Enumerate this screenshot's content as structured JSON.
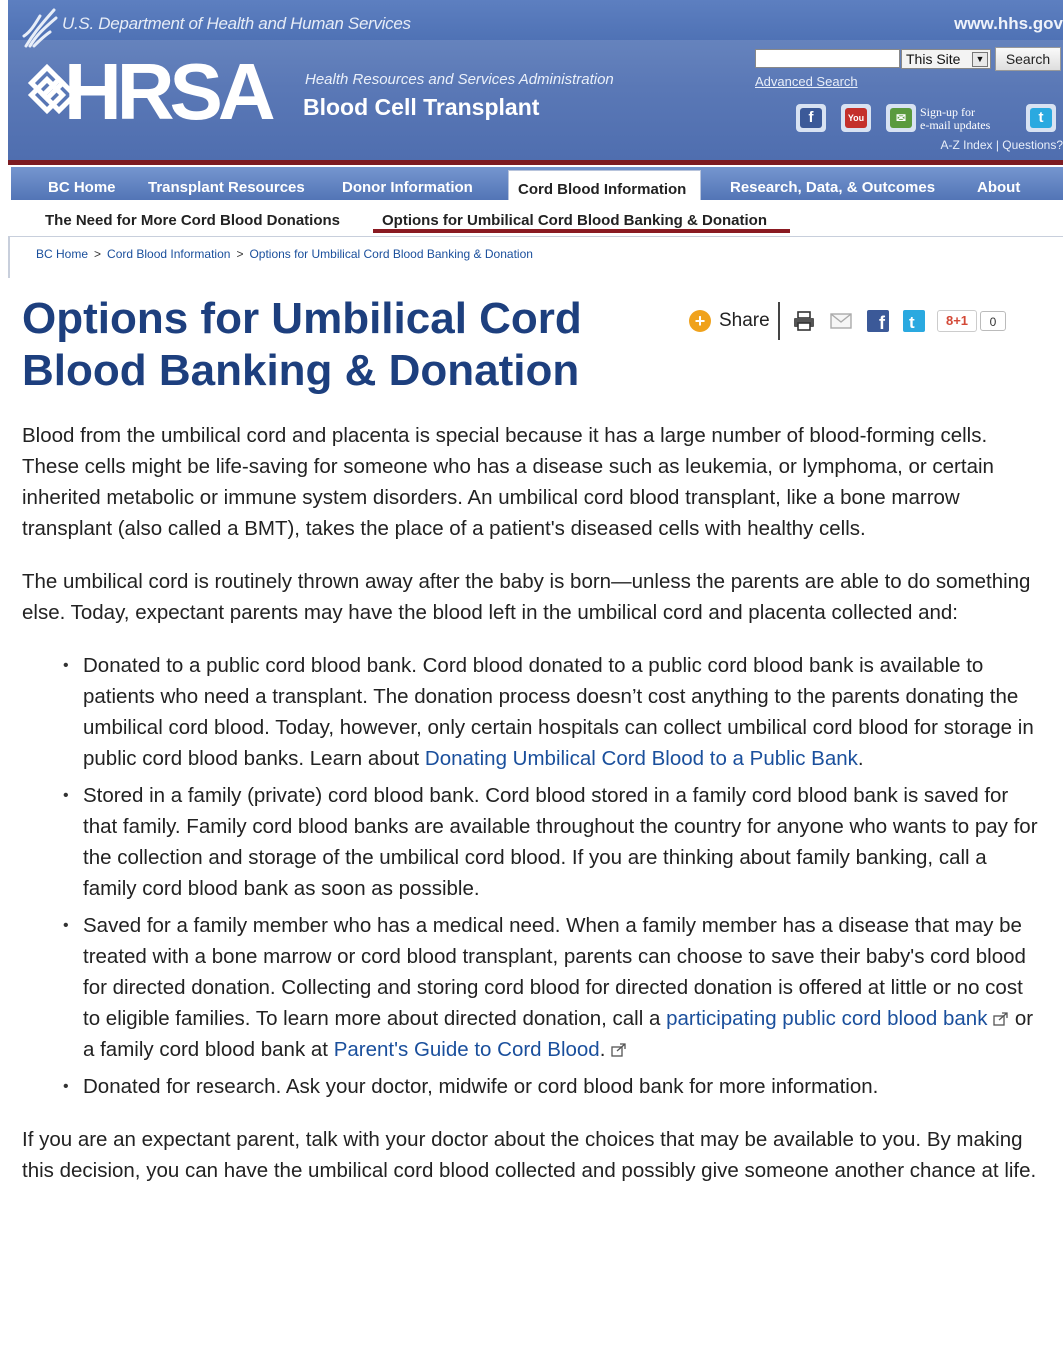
{
  "header": {
    "hhs_name": "U.S. Department of Health and Human Services",
    "hhs_url": "www.hhs.gov",
    "hrsa_word": "HRSA",
    "hrsa_full_name": "Health Resources and Services Administration",
    "program_name": "Blood Cell Transplant",
    "search": {
      "input_value": "",
      "scope_selected": "This Site",
      "button_label": "Search",
      "advanced_link": "Advanced Search"
    },
    "signup_line1": "Sign-up for",
    "signup_line2": "e-mail updates",
    "az_index": "A-Z Index",
    "questions": "Questions?"
  },
  "nav": {
    "items": [
      {
        "label": "BC Home"
      },
      {
        "label": "Transplant Resources"
      },
      {
        "label": "Donor Information"
      },
      {
        "label": "Cord Blood Information"
      },
      {
        "label": "Research, Data, & Outcomes"
      },
      {
        "label": "About"
      }
    ],
    "active_index": 3
  },
  "subnav": {
    "items": [
      {
        "label": "The Need for More Cord Blood Donations"
      },
      {
        "label": "Options for Umbilical Cord Blood Banking & Donation"
      }
    ],
    "active_index": 1
  },
  "breadcrumb": {
    "items": [
      "BC Home",
      "Cord Blood Information",
      "Options for Umbilical Cord Blood Banking & Donation"
    ],
    "separator": ">"
  },
  "page": {
    "title": "Options for Umbilical Cord Blood Banking & Donation",
    "share_label": "Share",
    "share_count": "0",
    "gplus_label": "8+1",
    "para1": "Blood from the umbilical cord and placenta is special because it has a large number of blood-forming cells. These cells might be life-saving for someone who has a disease such as leukemia, or lymphoma, or certain inherited metabolic or immune system disorders. An umbilical cord blood transplant, like a bone marrow transplant (also called a BMT), takes the place of a patient's diseased cells with healthy cells.",
    "para2": "The umbilical cord is routinely thrown away after the baby is born—unless the parents are able to do something else. Today, expectant parents may have the blood left in the umbilical cord and placenta collected and:",
    "bullets": [
      {
        "text": "Donated to a public cord blood bank. Cord blood donated to a public cord blood bank is available to patients who need a transplant. The donation process doesn’t cost anything to the parents donating the umbilical cord blood. Today, however, only certain hospitals can collect umbilical cord blood for storage in public cord blood banks. Learn about ",
        "link": "Donating Umbilical Cord Blood to a Public Bank",
        "after": "."
      },
      {
        "text": "Stored in a family (private) cord blood bank. Cord blood stored in a family cord blood bank is saved for that family. Family cord blood banks are available throughout the country for anyone who wants to pay for the collection and storage of the umbilical cord blood. If you are thinking about family banking, call a family cord blood bank as soon as possible."
      },
      {
        "text": "Saved for a family member who has a medical need. When a family member has a disease that may be treated with a bone marrow or cord blood transplant, parents can choose to save their baby's cord blood for directed donation. Collecting and storing cord blood for directed donation is offered at little or no cost to eligible families. To learn more about directed donation, call a ",
        "link": "participating public cord blood bank",
        "middle": " or a family cord blood bank at ",
        "link2": "Parent's Guide to Cord Blood",
        "after": "."
      },
      {
        "text": "Donated for research. Ask your doctor, midwife or cord blood bank for more information."
      }
    ],
    "para3": "If you are an expectant parent, talk with your doctor about the choices that may be available to you. By making this decision, you can have the umbilical cord blood collected and possibly give someone another chance at life."
  },
  "colors": {
    "header_blue": "#5a78b6",
    "nav_blue": "#4d70b2",
    "accent_red": "#7c1b22",
    "title_blue": "#1d3f7e",
    "link_blue": "#1a4f9c"
  },
  "icons": [
    "eagle-icon",
    "hrsa-logo-icon",
    "facebook-icon",
    "youtube-icon",
    "email-updates-icon",
    "twitter-icon",
    "share-plus-icon",
    "print-icon",
    "email-icon",
    "external-link-icon"
  ]
}
